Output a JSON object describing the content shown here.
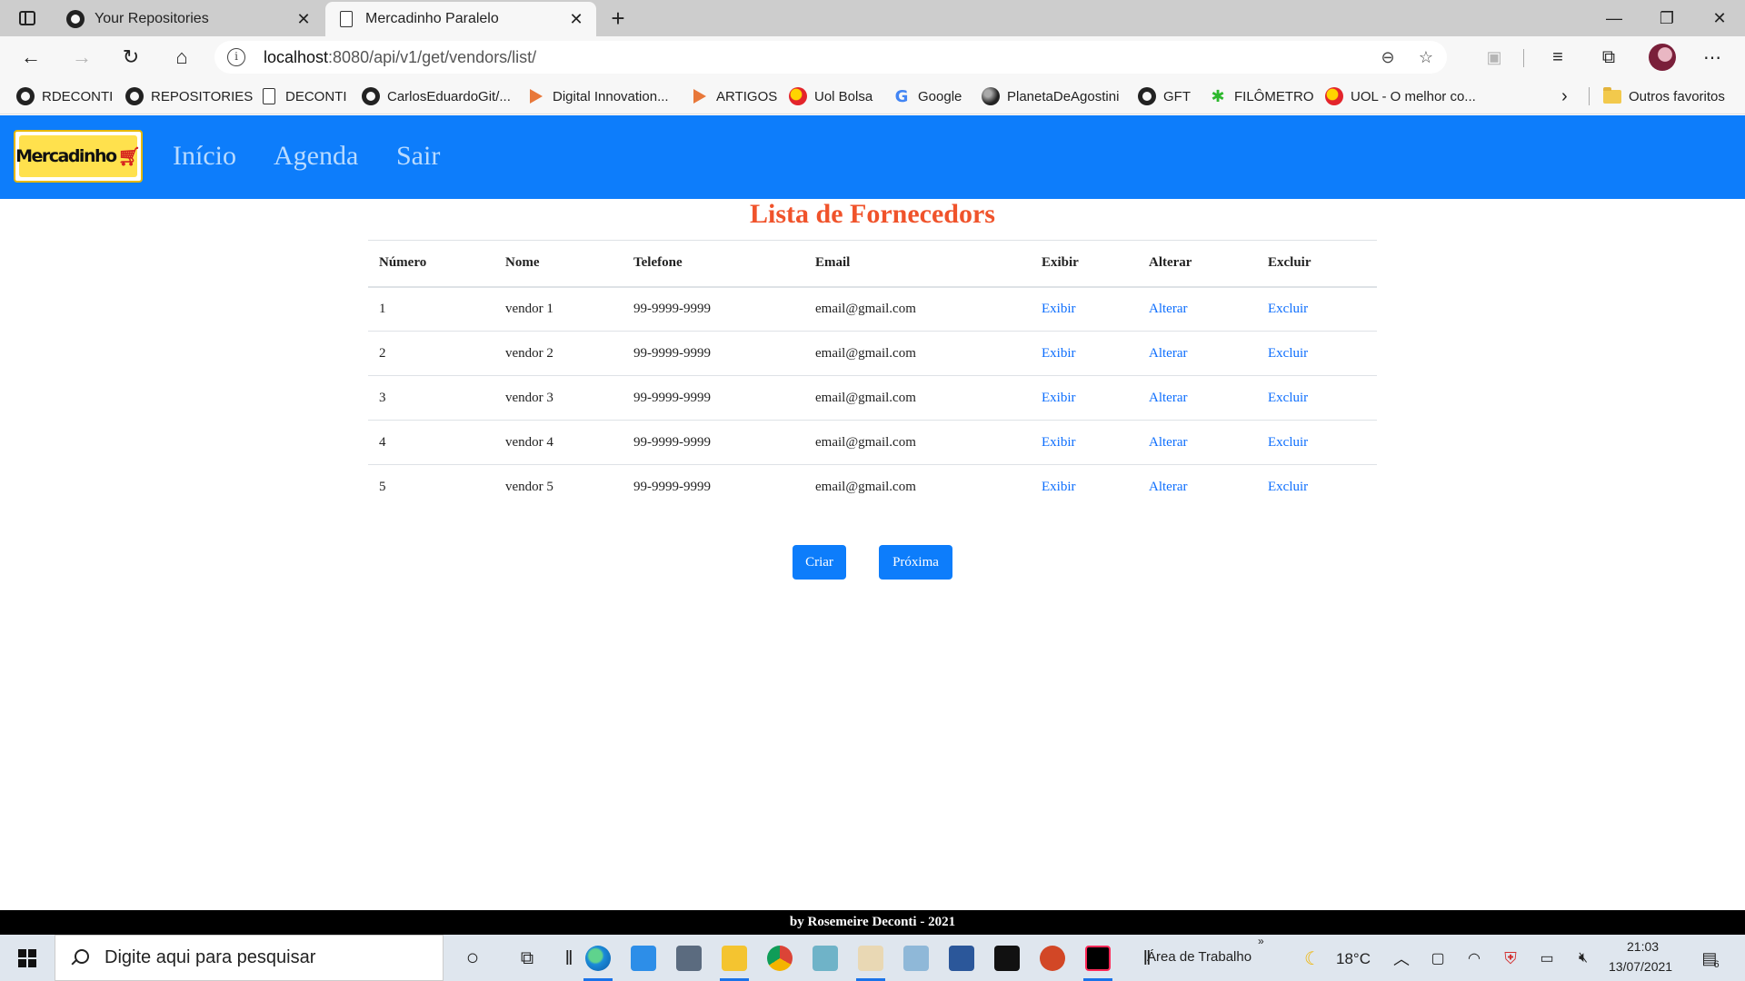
{
  "browser": {
    "tabs": [
      {
        "title": "Your Repositories",
        "active": false
      },
      {
        "title": "Mercadinho Paralelo",
        "active": true
      }
    ],
    "url_host": "localhost",
    "url_path": ":8080/api/v1/get/vendors/list/",
    "bookmarks": [
      {
        "label": "RDECONTI",
        "icon": "github-icon"
      },
      {
        "label": "REPOSITORIES",
        "icon": "github-icon"
      },
      {
        "label": "DECONTI",
        "icon": "document-icon"
      },
      {
        "label": "CarlosEduardoGit/...",
        "icon": "github-icon"
      },
      {
        "label": "Digital Innovation...",
        "icon": "dio-icon"
      },
      {
        "label": "ARTIGOS",
        "icon": "dio-icon"
      },
      {
        "label": "Uol Bolsa",
        "icon": "uol-icon"
      },
      {
        "label": "Google",
        "icon": "google-icon"
      },
      {
        "label": "PlanetaDeAgostini",
        "icon": "planet-icon"
      },
      {
        "label": "GFT",
        "icon": "github-icon"
      },
      {
        "label": "FILÔMETRO",
        "icon": "people-icon"
      },
      {
        "label": "UOL - O melhor co...",
        "icon": "uol-icon"
      }
    ],
    "other_favorites": "Outros favoritos"
  },
  "app": {
    "logo_text": "Mercadinho",
    "nav": [
      "Início",
      "Agenda",
      "Sair"
    ],
    "title": "Lista de Fornecedors",
    "table": {
      "headers": [
        "Número",
        "Nome",
        "Telefone",
        "Email",
        "Exibir",
        "Alterar",
        "Excluir"
      ],
      "rows": [
        {
          "numero": "1",
          "nome": "vendor 1",
          "telefone": "99-9999-9999",
          "email": "email@gmail.com"
        },
        {
          "numero": "2",
          "nome": "vendor 2",
          "telefone": "99-9999-9999",
          "email": "email@gmail.com"
        },
        {
          "numero": "3",
          "nome": "vendor 3",
          "telefone": "99-9999-9999",
          "email": "email@gmail.com"
        },
        {
          "numero": "4",
          "nome": "vendor 4",
          "telefone": "99-9999-9999",
          "email": "email@gmail.com"
        },
        {
          "numero": "5",
          "nome": "vendor 5",
          "telefone": "99-9999-9999",
          "email": "email@gmail.com"
        }
      ],
      "link_labels": {
        "show": "Exibir",
        "edit": "Alterar",
        "delete": "Excluir"
      }
    },
    "buttons": {
      "create": "Criar",
      "next": "Próxima"
    },
    "footer": "by Rosemeire Deconti - 2021"
  },
  "taskbar": {
    "search_placeholder": "Digite aqui para pesquisar",
    "desktop_label": "Área de Trabalho",
    "temperature": "18°C",
    "time": "21:03",
    "date": "13/07/2021",
    "notifications": "6"
  },
  "colors": {
    "brand_blue": "#0d7dfb",
    "title_orange": "#f0532b",
    "link_blue": "#0d6efd"
  }
}
